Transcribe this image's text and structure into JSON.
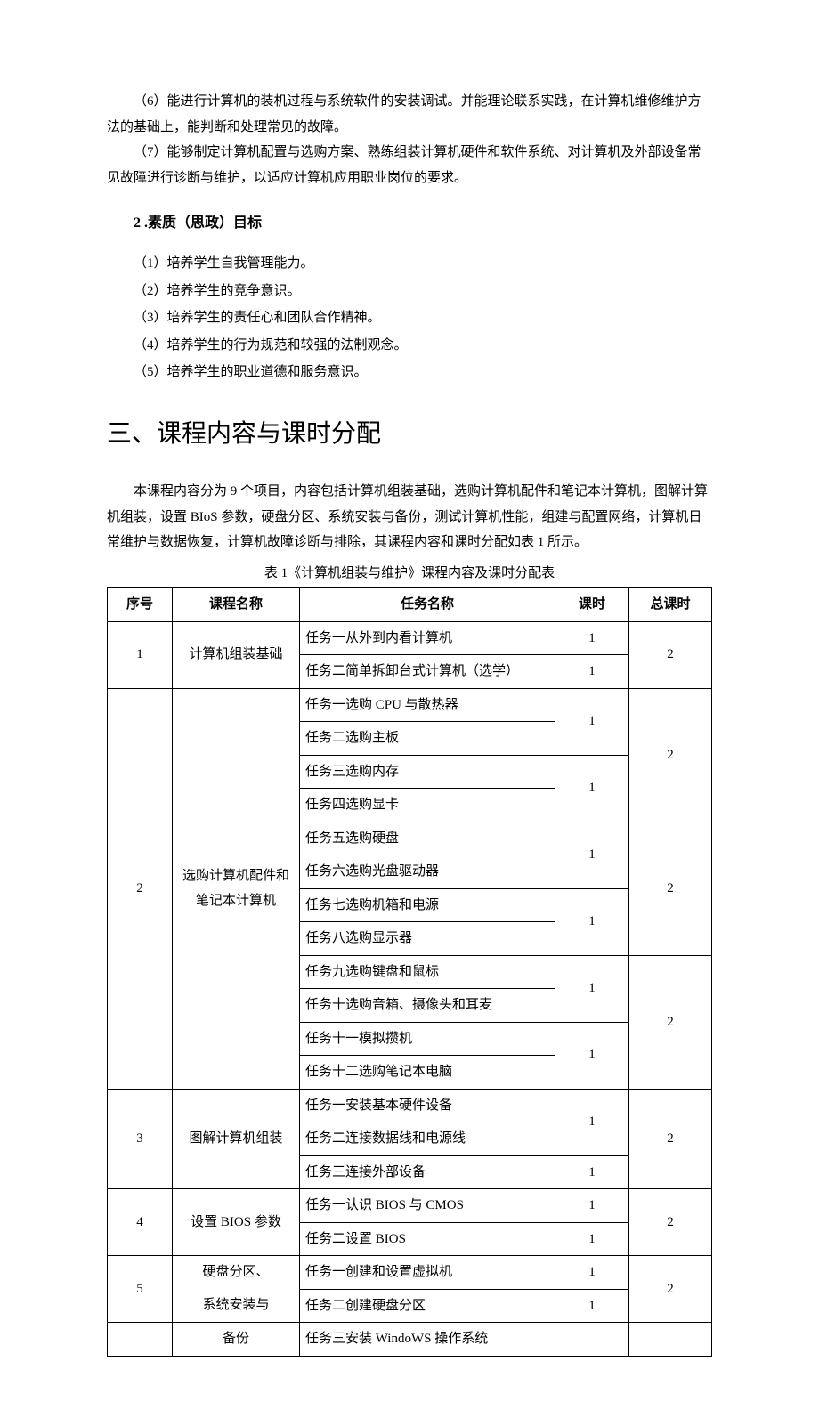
{
  "intro": {
    "p6": "（6）能进行计算机的装机过程与系统软件的安装调试。并能理论联系实践，在计算机维修维护方法的基础上，能判断和处理常见的故障。",
    "p7": "（7）能够制定计算机配置与选购方案、熟练组装计算机硬件和软件系统、对计算机及外部设备常见故障进行诊断与维护，以适应计算机应用职业岗位的要求。"
  },
  "section2": {
    "heading": "2 .素质（思政）目标",
    "items": [
      "（1）培养学生自我管理能力。",
      "（2）培养学生的竞争意识。",
      "（3）培养学生的责任心和团队合作精神。",
      "（4）培养学生的行为规范和较强的法制观念。",
      "（5）培养学生的职业道德和服务意识。"
    ]
  },
  "section3": {
    "heading": "三、课程内容与课时分配",
    "para": "本课程内容分为 9 个项目，内容包括计算机组装基础，选购计算机配件和笔记本计算机，图解计算机组装，设置 BIoS 参数，硬盘分区、系统安装与备份，测试计算机性能，组建与配置网络，计算机日常维护与数据恢复，计算机故障诊断与排除，其课程内容和课时分配如表 1 所示。",
    "caption": "表 1《计算机组装与维护》课程内容及课时分配表"
  },
  "table": {
    "headers": [
      "序号",
      "课程名称",
      "任务名称",
      "课时",
      "总课时"
    ],
    "rows": {
      "r1_course": "计算机组装基础",
      "r1_t1": "任务一从外到内看计算机",
      "r1_t2": "任务二简单拆卸台式计算机（选学）",
      "r2_course": "选购计算机配件和笔记本计算机",
      "r2_t1": "任务一选购 CPU 与散热器",
      "r2_t2": "任务二选购主板",
      "r2_t3": "任务三选购内存",
      "r2_t4": "任务四选购显卡",
      "r2_t5": "任务五选购硬盘",
      "r2_t6": "任务六选购光盘驱动器",
      "r2_t7": "任务七选购机箱和电源",
      "r2_t8": "任务八选购显示器",
      "r2_t9": "任务九选购键盘和鼠标",
      "r2_t10": "任务十选购音箱、摄像头和耳麦",
      "r2_t11": "任务十一模拟攒机",
      "r2_t12": "任务十二选购笔记本电脑",
      "r3_course": "图解计算机组装",
      "r3_t1": "任务一安装基本硬件设备",
      "r3_t2": "任务二连接数据线和电源线",
      "r3_t3": "任务三连接外部设备",
      "r4_course": "设置 BIOS 参数",
      "r4_t1": "任务一认识 BIOS 与 CMOS",
      "r4_t2": "任务二设置 BIOS",
      "r5_course_a": "硬盘分区、",
      "r5_course_b": "系统安装与",
      "r5_course_c": "备份",
      "r5_t1": "任务一创建和设置虚拟机",
      "r5_t2": "任务二创建硬盘分区",
      "r5_t3": "任务三安装 WindoWS 操作系统",
      "n1": "1",
      "n2": "2",
      "n3": "3",
      "n4": "4",
      "n5": "5",
      "h1": "1",
      "tot2": "2"
    }
  }
}
